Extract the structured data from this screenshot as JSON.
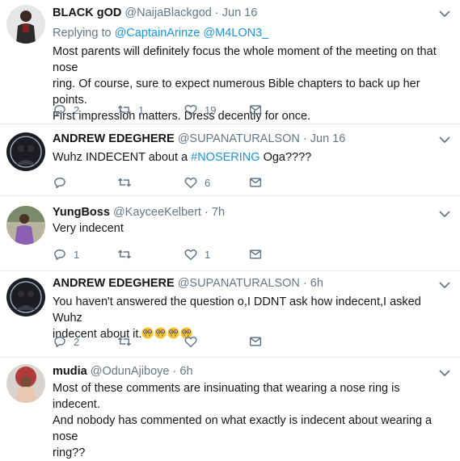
{
  "tweets": [
    {
      "name": "BLACK gOD",
      "handle": "@NaijaBlackgod",
      "sep": "·",
      "time": "Jun 16",
      "replying_label": "Replying to",
      "replying_to": [
        "@CaptainArinze",
        "@M4LON3_"
      ],
      "body": [
        "Most parents will definitely focus the whole moment of the meeting on that nose",
        "ring. Of course, sure to expect numerous Bible chapters to back up her points.",
        "First impression matters. Dress decently for once."
      ],
      "replies": "2",
      "retweets": "1",
      "likes": "19"
    },
    {
      "name": "ANDREW EDEGHERE",
      "handle": "@SUPANATURALSON",
      "sep": "·",
      "time": "Jun 16",
      "body_pre": "Wuhz INDECENT about a ",
      "hashtag": "#NOSERING",
      "body_post": " Oga????",
      "replies": "",
      "retweets": "",
      "likes": "6"
    },
    {
      "name": "YungBoss",
      "handle": "@KayceeKelbert",
      "sep": "·",
      "time": "7h",
      "body": [
        "Very indecent"
      ],
      "replies": "1",
      "retweets": "",
      "likes": "1"
    },
    {
      "name": "ANDREW EDEGHERE",
      "handle": "@SUPANATURALSON",
      "sep": "·",
      "time": "6h",
      "body": [
        "You haven't answered the question o,I DDNT ask how indecent,I asked Wuhz",
        "indecent about it."
      ],
      "emoji": "nerd-face",
      "replies": "2",
      "retweets": "",
      "likes": ""
    },
    {
      "name": "mudia",
      "handle": "@OdunAjiboye",
      "sep": "·",
      "time": "6h",
      "body": [
        "Most of these comments are insinuating that wearing a nose ring is indecent.",
        "And nobody has commented on what exactly is indecent about wearing a nose",
        "ring??"
      ]
    }
  ],
  "icons": {
    "reply": "reply-icon",
    "retweet": "retweet-icon",
    "like": "heart-icon",
    "dm": "direct-message-icon",
    "more": "chevron-down-icon"
  },
  "colors": {
    "accent": "#1b95e0",
    "muted": "#657786",
    "divider": "#e6ecf0"
  }
}
